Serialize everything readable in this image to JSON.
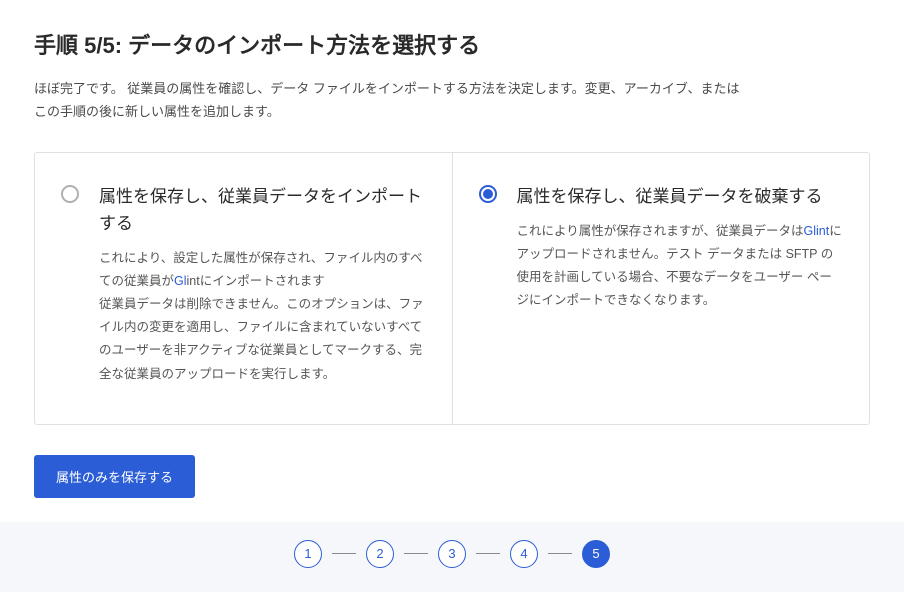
{
  "header": {
    "title": "手順 5/5: データのインポート方法を選択する",
    "description_l1": "ほぼ完了です。 従業員の属性を確認し、データ ファイルをインポートする方法を決定します。変更、アーカイブ、または",
    "description_l2": "この手順の後に新しい属性を追加します。"
  },
  "options": {
    "left": {
      "selected": false,
      "title": "属性を保存し、従業員データをインポートする",
      "desc_p1a": "これにより、設定した属性が保存され、ファイル内のすべての従業員が",
      "desc_p1_hl": "Gl",
      "desc_p1b": "intにインポートされます",
      "desc_p2": "従業員データは削除できません。このオプションは、ファイル内の変更を適用し、ファイルに含まれていないすべてのユーザーを非アクティブな従業員としてマークする、完全な従業員のアップロードを実行します。"
    },
    "right": {
      "selected": true,
      "title": "属性を保存し、従業員データを破棄する",
      "desc_a": "これにより属性が保存されますが、従業員データは",
      "desc_hl": "Glint",
      "desc_b": "にアップロードされません。テスト データまたは SFTP の使用を計画している場合、不要なデータをユーザー ページにインポートできなくなります。"
    }
  },
  "actions": {
    "save_attributes_only": "属性のみを保存する"
  },
  "stepper": {
    "steps": [
      "1",
      "2",
      "3",
      "4",
      "5"
    ],
    "current": 5
  }
}
